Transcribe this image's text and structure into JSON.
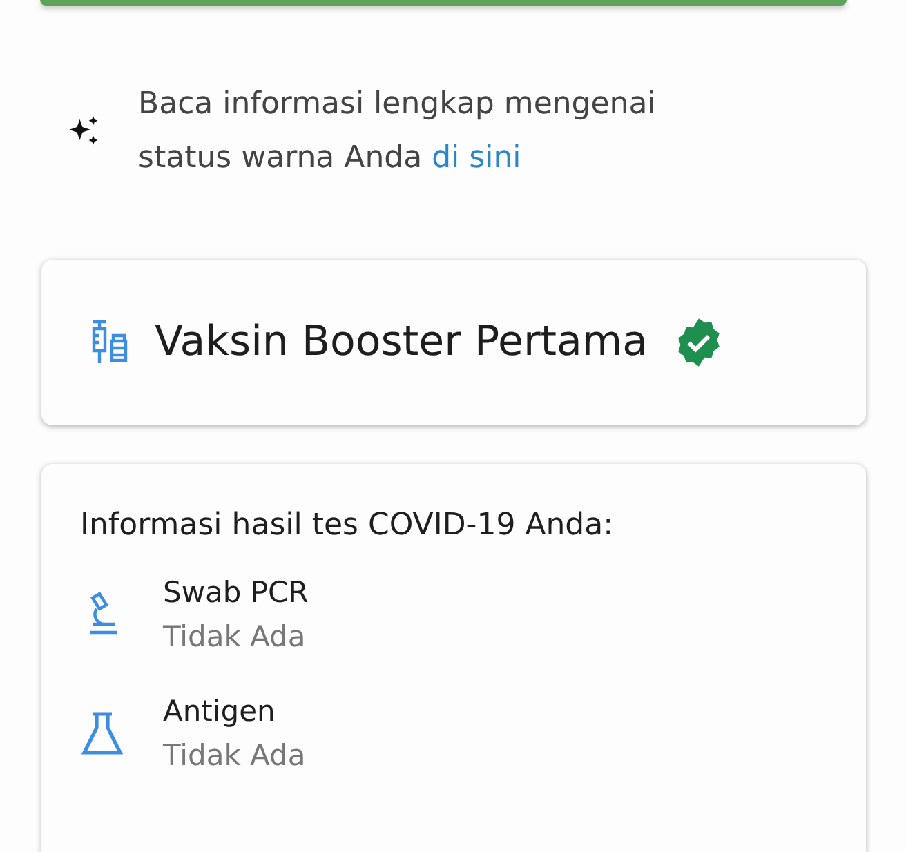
{
  "status_card": {
    "color": "#5ea35a"
  },
  "info": {
    "text": "Baca informasi lengkap mengenai status warna Anda ",
    "link": "di sini"
  },
  "vaccine": {
    "title": "Vaksin Booster Pertama",
    "verified": true
  },
  "tests": {
    "heading": "Informasi hasil tes COVID-19 Anda:",
    "items": [
      {
        "kind": "pcr",
        "name": "Swab PCR",
        "result": "Tidak Ada"
      },
      {
        "kind": "antigen",
        "name": "Antigen",
        "result": "Tidak Ada"
      }
    ]
  }
}
